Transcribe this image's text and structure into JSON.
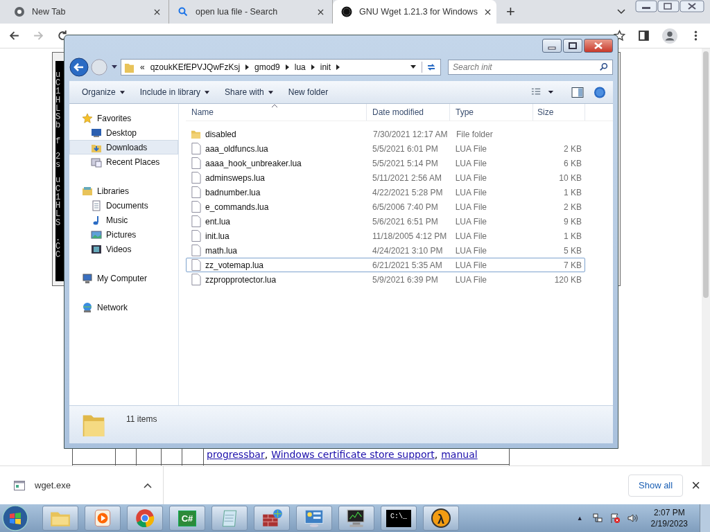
{
  "browser": {
    "tabs": [
      {
        "title": "New Tab",
        "kind": "newtab",
        "selected": false
      },
      {
        "title": "open lua file - Search",
        "kind": "search",
        "selected": false
      },
      {
        "title": "GNU Wget 1.21.3 for Windows",
        "kind": "site",
        "selected": true
      }
    ],
    "new_tab": "+"
  },
  "page": {
    "console_columns": [
      "uC1HLSb",
      "f",
      "2s",
      "uC1HLS",
      ".CC"
    ],
    "table_row": {
      "links": [
        "progressbar",
        "Windows certificate store support",
        "manual"
      ],
      "separator": ","
    }
  },
  "explorer": {
    "breadcrumb": [
      "«",
      "qzoukKEfEPVJQwFzKsj",
      "gmod9",
      "lua",
      "init"
    ],
    "search": {
      "placeholder": "Search init"
    },
    "commands": [
      {
        "label": "Organize",
        "dropdown": true
      },
      {
        "label": "Include in library",
        "dropdown": true
      },
      {
        "label": "Share with",
        "dropdown": true
      },
      {
        "label": "New folder",
        "dropdown": false
      }
    ],
    "nav": [
      {
        "label": "Favorites",
        "kind": "star",
        "children": [
          {
            "label": "Desktop",
            "kind": "desktop",
            "selected": false
          },
          {
            "label": "Downloads",
            "kind": "downloads",
            "selected": true
          },
          {
            "label": "Recent Places",
            "kind": "recent",
            "selected": false
          }
        ]
      },
      {
        "label": "Libraries",
        "kind": "library",
        "children": [
          {
            "label": "Documents",
            "kind": "documents",
            "selected": false
          },
          {
            "label": "Music",
            "kind": "music",
            "selected": false
          },
          {
            "label": "Pictures",
            "kind": "pictures",
            "selected": false
          },
          {
            "label": "Videos",
            "kind": "videos",
            "selected": false
          }
        ]
      },
      {
        "label": "My Computer",
        "kind": "computer"
      },
      {
        "label": "Network",
        "kind": "network"
      }
    ],
    "columns": [
      "Name",
      "Date modified",
      "Type",
      "Size"
    ],
    "files": [
      {
        "name": "disabled",
        "date": "7/30/2021 12:17 AM",
        "type": "File folder",
        "kind": "folder",
        "selected": false
      },
      {
        "name": "aaa_oldfuncs.lua",
        "date": "5/5/2021 6:01 PM",
        "type": "LUA File",
        "size": "2 KB",
        "kind": "file",
        "selected": false
      },
      {
        "name": "aaaa_hook_unbreaker.lua",
        "date": "5/5/2021 5:14 PM",
        "type": "LUA File",
        "size": "6 KB",
        "kind": "file",
        "selected": false
      },
      {
        "name": "adminsweps.lua",
        "date": "5/11/2021 2:56 AM",
        "type": "LUA File",
        "size": "10 KB",
        "kind": "file",
        "selected": false
      },
      {
        "name": "badnumber.lua",
        "date": "4/22/2021 5:28 PM",
        "type": "LUA File",
        "size": "1 KB",
        "kind": "file",
        "selected": false
      },
      {
        "name": "e_commands.lua",
        "date": "6/5/2006 7:40 PM",
        "type": "LUA File",
        "size": "2 KB",
        "kind": "file",
        "selected": false
      },
      {
        "name": "ent.lua",
        "date": "5/6/2021 6:51 PM",
        "type": "LUA File",
        "size": "9 KB",
        "kind": "file",
        "selected": false
      },
      {
        "name": "init.lua",
        "date": "11/18/2005 4:12 PM",
        "type": "LUA File",
        "size": "1 KB",
        "kind": "file",
        "selected": false
      },
      {
        "name": "math.lua",
        "date": "4/24/2021 3:10 PM",
        "type": "LUA File",
        "size": "5 KB",
        "kind": "file",
        "selected": false
      },
      {
        "name": "zz_votemap.lua",
        "date": "6/21/2021 5:35 AM",
        "type": "LUA File",
        "size": "7 KB",
        "kind": "file",
        "selected": true
      },
      {
        "name": "zzpropprotector.lua",
        "date": "5/9/2021 6:39 PM",
        "type": "LUA File",
        "size": "120 KB",
        "kind": "file",
        "selected": false
      }
    ],
    "status": "11 items"
  },
  "downloads": {
    "file": "wget.exe",
    "show_all": "Show all",
    "close": "×"
  },
  "taskbar": {
    "items": [
      {
        "kind": "folder"
      },
      {
        "kind": "media"
      },
      {
        "kind": "browser"
      },
      {
        "kind": "code",
        "glyph": "C#"
      },
      {
        "kind": "notepad"
      },
      {
        "kind": "firewall"
      },
      {
        "kind": "panel"
      },
      {
        "kind": "monitor"
      },
      {
        "kind": "console",
        "glyph": "C:\\_"
      },
      {
        "kind": "lambda",
        "glyph": "λ"
      }
    ],
    "tray_expand": "▲",
    "time": "2:07 PM",
    "date": "2/19/2023"
  }
}
